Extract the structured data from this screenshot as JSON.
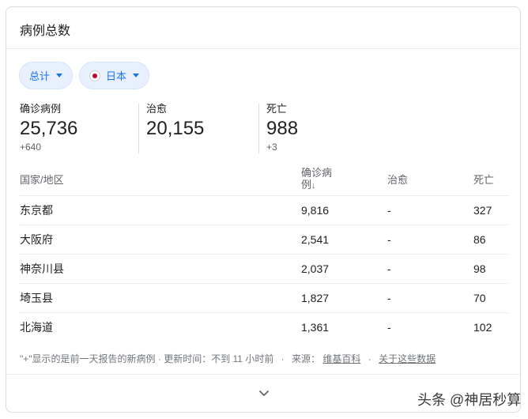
{
  "card": {
    "title": "病例总数"
  },
  "filters": {
    "total_label": "总计",
    "country_label": "日本"
  },
  "stats": {
    "cases": {
      "label": "确诊病例",
      "value": "25,736",
      "delta": "+640"
    },
    "recovered": {
      "label": "治愈",
      "value": "20,155"
    },
    "deaths": {
      "label": "死亡",
      "value": "988",
      "delta": "+3"
    }
  },
  "table": {
    "headers": {
      "region": "国家/地区",
      "cases_line1": "确诊病",
      "cases_line2": "例",
      "cases_sort": "↓",
      "recovered": "治愈",
      "deaths": "死亡"
    },
    "rows": [
      {
        "region": "东京都",
        "cases": "9,816",
        "recovered": "-",
        "deaths": "327"
      },
      {
        "region": "大阪府",
        "cases": "2,541",
        "recovered": "-",
        "deaths": "86"
      },
      {
        "region": "神奈川县",
        "cases": "2,037",
        "recovered": "-",
        "deaths": "98"
      },
      {
        "region": "埼玉县",
        "cases": "1,827",
        "recovered": "-",
        "deaths": "70"
      },
      {
        "region": "北海道",
        "cases": "1,361",
        "recovered": "-",
        "deaths": "102"
      }
    ]
  },
  "footer": {
    "note": "\"+\"显示的是前一天报告的新病例 · 更新时间：不到 11 小时前",
    "dot": "·",
    "source_label": "来源：",
    "source_link": "维基百科",
    "about_link": "关于这些数据"
  },
  "watermark": "头条 @神居秒算",
  "colors": {
    "accent": "#1a73e8",
    "chip_bg": "#e8f0fe",
    "flag_red": "#bc002d"
  }
}
